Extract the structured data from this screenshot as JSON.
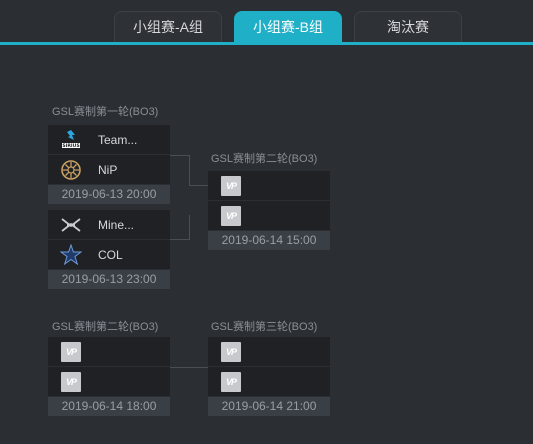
{
  "tabs": [
    {
      "label": "小组赛-A组",
      "active": false
    },
    {
      "label": "小组赛-B组",
      "active": true
    },
    {
      "label": "淘汰赛",
      "active": false
    }
  ],
  "colors": {
    "accent": "#1fb0c8",
    "background": "#2b2e33",
    "team_row": "#1f2125",
    "time_row": "#3a3e45"
  },
  "upper": {
    "round1": {
      "title": "GSL赛制第一轮(BO3)",
      "matches": [
        {
          "teams": [
            {
              "name": "Team...",
              "logo": "sirius-logo-icon"
            },
            {
              "name": "NiP",
              "logo": "nip-logo-icon"
            }
          ],
          "time": "2019-06-13 20:00"
        },
        {
          "teams": [
            {
              "name": "Mine...",
              "logo": "mineski-logo-icon"
            },
            {
              "name": "COL",
              "logo": "col-logo-icon"
            }
          ],
          "time": "2019-06-13 23:00"
        }
      ]
    },
    "round2": {
      "title": "GSL赛制第二轮(BO3)",
      "match": {
        "placeholder_logo": "VP",
        "time": "2019-06-14 15:00"
      }
    }
  },
  "lower": {
    "round2": {
      "title": "GSL赛制第二轮(BO3)",
      "match": {
        "placeholder_logo": "VP",
        "time": "2019-06-14 18:00"
      }
    },
    "round3": {
      "title": "GSL赛制第三轮(BO3)",
      "match": {
        "placeholder_logo": "VP",
        "time": "2019-06-14 21:00"
      }
    }
  }
}
